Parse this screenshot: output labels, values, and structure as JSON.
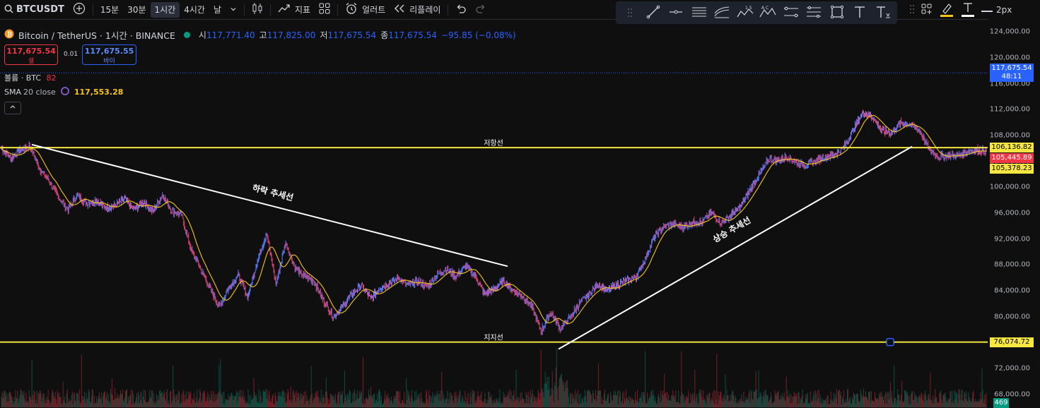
{
  "toolbar": {
    "symbol": "BTCUSDT",
    "intervals": [
      "15분",
      "30분",
      "1시간",
      "4시간",
      "날"
    ],
    "active_interval": "1시간",
    "indicators_label": "지표",
    "alert_label": "얼러트",
    "replay_label": "리플레이"
  },
  "drawing_toolbar": {
    "tools": [
      "trend-line",
      "horizontal-ray",
      "parallel-channel",
      "regression",
      "xabcd-pattern",
      "abcd-pattern",
      "range",
      "date-range",
      "rectangle",
      "text",
      "text-note"
    ],
    "xabcd_label": "1 5",
    "abcd_label": "A C",
    "line_width_label": "2px",
    "accent_color": "#f5c518"
  },
  "legend": {
    "title": "Bitcoin / TetherUS · 1시간 · BINANCE",
    "open_label": "시",
    "open": "117,771.40",
    "high_label": "고",
    "high": "117,825.00",
    "low_label": "저",
    "low": "117,675.54",
    "close_label": "종",
    "close": "117,675.54",
    "change": "−95.85 (−0.08%)"
  },
  "trade": {
    "sell_price": "117,675.54",
    "sell_label": "셀",
    "spread": "0.01",
    "buy_price": "117,675.55",
    "buy_label": "바이"
  },
  "volume_legend": {
    "label": "볼륨 · BTC",
    "value": "82"
  },
  "sma_legend": {
    "label": "SMA",
    "params": "20 close",
    "value": "117,553.28"
  },
  "annotations": {
    "resistance": "저항선",
    "support": "지지선",
    "downtrend": "하락 추세선",
    "uptrend": "상승 추세선"
  },
  "price_axis": {
    "ticks": [
      "124,000.00",
      "120,000.00",
      "116,000.00",
      "112,000.00",
      "108,000.00",
      "104,000.00",
      "100,000.00",
      "96,000.00",
      "92,000.00",
      "88,000.00",
      "84,000.00",
      "80,000.00",
      "76,000.00",
      "72,000.00",
      "68,000.00"
    ],
    "current_price": "117,675.54",
    "countdown": "48:11",
    "resistance_price": "106,136.82",
    "red_price": "105,445.89",
    "sma_price": "105,378.23",
    "support_price": "76,074.72",
    "volume_value": "469"
  },
  "colors": {
    "background": "#0f0f0f",
    "level_line": "#f5e642",
    "up": "#089981",
    "down": "#f23645",
    "blue": "#2962ff",
    "sma": "#f5c518"
  },
  "chart_data": {
    "type": "line",
    "title": "Bitcoin / TetherUS · 1시간 · BINANCE",
    "ylim": [
      66000,
      126000
    ],
    "series": [
      {
        "name": "BTCUSDT",
        "values": [
          106000,
          104500,
          105800,
          106400,
          103000,
          101000,
          98500,
          96500,
          98800,
          97500,
          98000,
          96800,
          97200,
          98200,
          96500,
          97800,
          96200,
          98800,
          96400,
          95800,
          90500,
          87500,
          84500,
          81500,
          84500,
          86500,
          83000,
          88500,
          93000,
          85000,
          91500,
          87500,
          86200,
          85500,
          82500,
          80000,
          81500,
          83500,
          84800,
          82800,
          84500,
          85200,
          86000,
          84800,
          85500,
          84600,
          86500,
          87400,
          86200,
          87800,
          86400,
          83500,
          84200,
          85600,
          84000,
          83200,
          81500,
          77800,
          80800,
          78200,
          79800,
          82000,
          83400,
          85000,
          84000,
          84900,
          85600,
          86100,
          89000,
          92500,
          93900,
          94300,
          93800,
          94600,
          94700,
          96000,
          94500,
          95600,
          97000,
          99500,
          101900,
          104300,
          104200,
          104700,
          103800,
          103500,
          104100,
          104700,
          105000,
          106300,
          109000,
          111700,
          110800,
          108700,
          108400,
          110000,
          109600,
          108700,
          105800,
          104700,
          105000,
          104800,
          105600,
          105800,
          105500
        ]
      }
    ],
    "levels": [
      {
        "name": "저항선",
        "value": 106136.82
      },
      {
        "name": "지지선",
        "value": 76074.72
      }
    ],
    "trendlines": [
      {
        "name": "하락 추세선",
        "from": 106600,
        "to": 87800
      },
      {
        "name": "상승 추세선",
        "from": 75000,
        "to": 106300
      }
    ],
    "grid": false
  }
}
